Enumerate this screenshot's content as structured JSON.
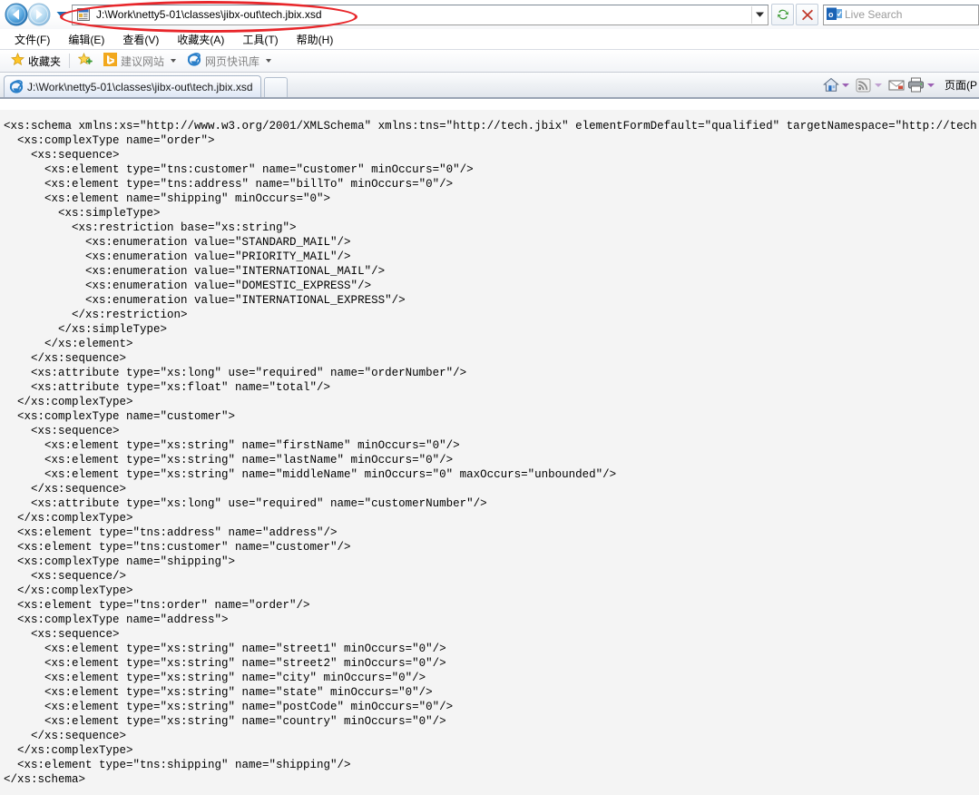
{
  "browser": {
    "nav": {
      "back_label": "Back",
      "forward_label": "Forward",
      "recent_pages_label": "Recent Pages",
      "refresh_label": "Refresh",
      "stop_label": "Stop"
    },
    "address": {
      "value": "J:\\Work\\netty5-01\\classes\\jibx-out\\tech.jbix.xsd",
      "dropdown_label": "Address history"
    },
    "search": {
      "placeholder": "Live Search",
      "provider": "Live Search"
    },
    "menu": [
      {
        "label": "文件(F)",
        "name": "menu-file"
      },
      {
        "label": "编辑(E)",
        "name": "menu-edit"
      },
      {
        "label": "查看(V)",
        "name": "menu-view"
      },
      {
        "label": "收藏夹(A)",
        "name": "menu-favorites"
      },
      {
        "label": "工具(T)",
        "name": "menu-tools"
      },
      {
        "label": "帮助(H)",
        "name": "menu-help"
      }
    ],
    "favorites": {
      "bar_label": "收藏夹",
      "items": [
        {
          "label": "建议网站",
          "name": "favorites-suggested-sites"
        },
        {
          "label": "网页快讯库",
          "name": "favorites-web-slice-gallery"
        }
      ]
    },
    "tabs": [
      {
        "label": "J:\\Work\\netty5-01\\classes\\jibx-out\\tech.jbix.xsd",
        "active": true
      }
    ],
    "new_tab_label": "New Tab",
    "tools": {
      "home_label": "Home",
      "feeds_label": "Feeds",
      "mail_label": "Read Mail",
      "print_label": "Print",
      "page_menu_label": "页面(P"
    }
  },
  "annotation": {
    "color": "#e8262a",
    "target": "address-bar"
  },
  "content": {
    "type": "xml-source",
    "lines": [
      "<xs:schema xmlns:xs=\"http://www.w3.org/2001/XMLSchema\" xmlns:tns=\"http://tech.jbix\" elementFormDefault=\"qualified\" targetNamespace=\"http://tech.jbix\">",
      "  <xs:complexType name=\"order\">",
      "    <xs:sequence>",
      "      <xs:element type=\"tns:customer\" name=\"customer\" minOccurs=\"0\"/>",
      "      <xs:element type=\"tns:address\" name=\"billTo\" minOccurs=\"0\"/>",
      "      <xs:element name=\"shipping\" minOccurs=\"0\">",
      "        <xs:simpleType>",
      "          <xs:restriction base=\"xs:string\">",
      "            <xs:enumeration value=\"STANDARD_MAIL\"/>",
      "            <xs:enumeration value=\"PRIORITY_MAIL\"/>",
      "            <xs:enumeration value=\"INTERNATIONAL_MAIL\"/>",
      "            <xs:enumeration value=\"DOMESTIC_EXPRESS\"/>",
      "            <xs:enumeration value=\"INTERNATIONAL_EXPRESS\"/>",
      "          </xs:restriction>",
      "        </xs:simpleType>",
      "      </xs:element>",
      "    </xs:sequence>",
      "    <xs:attribute type=\"xs:long\" use=\"required\" name=\"orderNumber\"/>",
      "    <xs:attribute type=\"xs:float\" name=\"total\"/>",
      "  </xs:complexType>",
      "  <xs:complexType name=\"customer\">",
      "    <xs:sequence>",
      "      <xs:element type=\"xs:string\" name=\"firstName\" minOccurs=\"0\"/>",
      "      <xs:element type=\"xs:string\" name=\"lastName\" minOccurs=\"0\"/>",
      "      <xs:element type=\"xs:string\" name=\"middleName\" minOccurs=\"0\" maxOccurs=\"unbounded\"/>",
      "    </xs:sequence>",
      "    <xs:attribute type=\"xs:long\" use=\"required\" name=\"customerNumber\"/>",
      "  </xs:complexType>",
      "  <xs:element type=\"tns:address\" name=\"address\"/>",
      "  <xs:element type=\"tns:customer\" name=\"customer\"/>",
      "  <xs:complexType name=\"shipping\">",
      "    <xs:sequence/>",
      "  </xs:complexType>",
      "  <xs:element type=\"tns:order\" name=\"order\"/>",
      "  <xs:complexType name=\"address\">",
      "    <xs:sequence>",
      "      <xs:element type=\"xs:string\" name=\"street1\" minOccurs=\"0\"/>",
      "      <xs:element type=\"xs:string\" name=\"street2\" minOccurs=\"0\"/>",
      "      <xs:element type=\"xs:string\" name=\"city\" minOccurs=\"0\"/>",
      "      <xs:element type=\"xs:string\" name=\"state\" minOccurs=\"0\"/>",
      "      <xs:element type=\"xs:string\" name=\"postCode\" minOccurs=\"0\"/>",
      "      <xs:element type=\"xs:string\" name=\"country\" minOccurs=\"0\"/>",
      "    </xs:sequence>",
      "  </xs:complexType>",
      "  <xs:element type=\"tns:shipping\" name=\"shipping\"/>",
      "</xs:schema>"
    ]
  }
}
